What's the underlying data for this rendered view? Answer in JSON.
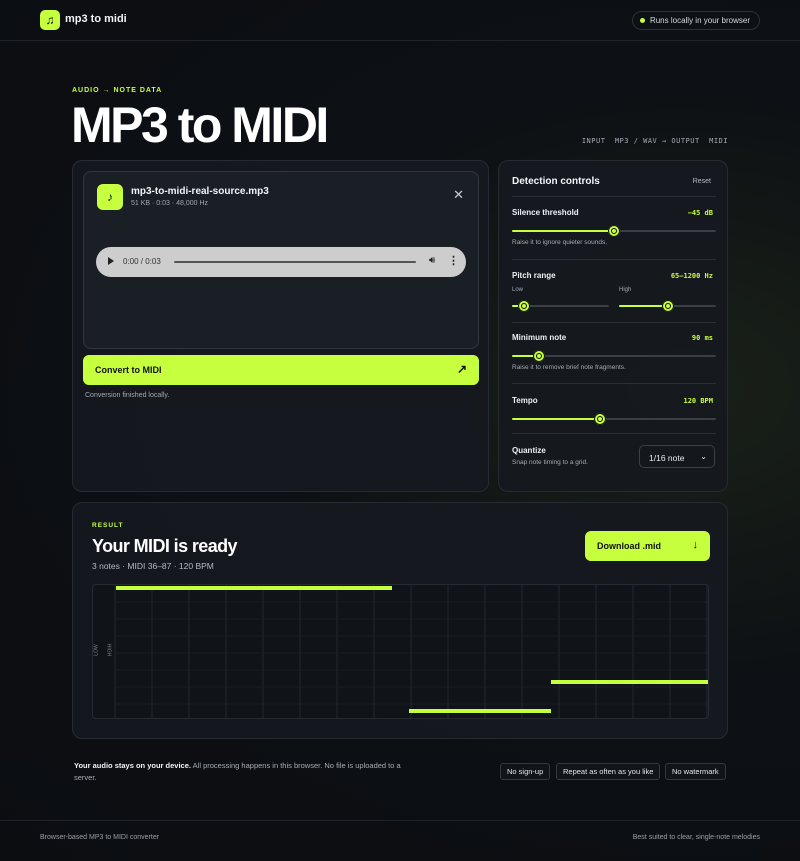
{
  "app": {
    "logo_icon": "music-note-icon",
    "name": "mp3 to midi",
    "local_badge": "Runs locally in your browser"
  },
  "hero": {
    "eyebrow": "AUDIO → NOTE DATA",
    "title": "MP3 to MIDI",
    "io_label": "INPUT  MP3 / WAV → OUTPUT  MIDI"
  },
  "file": {
    "icon": "music-note-icon",
    "name": "mp3-to-midi-real-source.mp3",
    "meta": "51 KB · 0:03 · 48,000 Hz",
    "close_icon": "close-icon",
    "player_time": "0:00 / 0:03"
  },
  "convert": {
    "label": "Convert to MIDI",
    "icon": "arrow-up-right-icon",
    "status": "Conversion finished locally."
  },
  "controls": {
    "title": "Detection controls",
    "reset": "Reset",
    "silence": {
      "label": "Silence threshold",
      "value": "−45 dB",
      "hint": "Raise it to ignore quieter sounds.",
      "level": 0.5
    },
    "pitch": {
      "label": "Pitch range",
      "value": "65–1200 Hz",
      "low_label": "Low",
      "high_label": "High",
      "low_level": 0.12,
      "high_level": 0.5
    },
    "min_note": {
      "label": "Minimum note",
      "value": "90 ms",
      "hint": "Raise it to remove brief note fragments.",
      "level": 0.13
    },
    "tempo": {
      "label": "Tempo",
      "value": "120 BPM",
      "level": 0.43
    },
    "quantize": {
      "label": "Quantize",
      "hint": "Snap note timing to a grid.",
      "selected": "1/16 note"
    }
  },
  "result": {
    "eyebrow": "RESULT",
    "title": "Your MIDI is ready",
    "summary": "3 notes · MIDI 36–87 · 120 BPM",
    "download": "Download .mid",
    "download_icon": "arrow-down-icon",
    "axis_low": "LOW",
    "axis_high": "HIGH",
    "accent": "#c6ff3d"
  },
  "privacy": {
    "lead": "Your audio stays on your device.",
    "text": " All processing happens in this browser. No file is uploaded to a server."
  },
  "chips": [
    "No sign-up",
    "Repeat as often as you like",
    "No watermark"
  ],
  "footer": {
    "left": "Browser-based MP3 to MIDI converter",
    "right": "Best suited to clear, single-note melodies"
  }
}
